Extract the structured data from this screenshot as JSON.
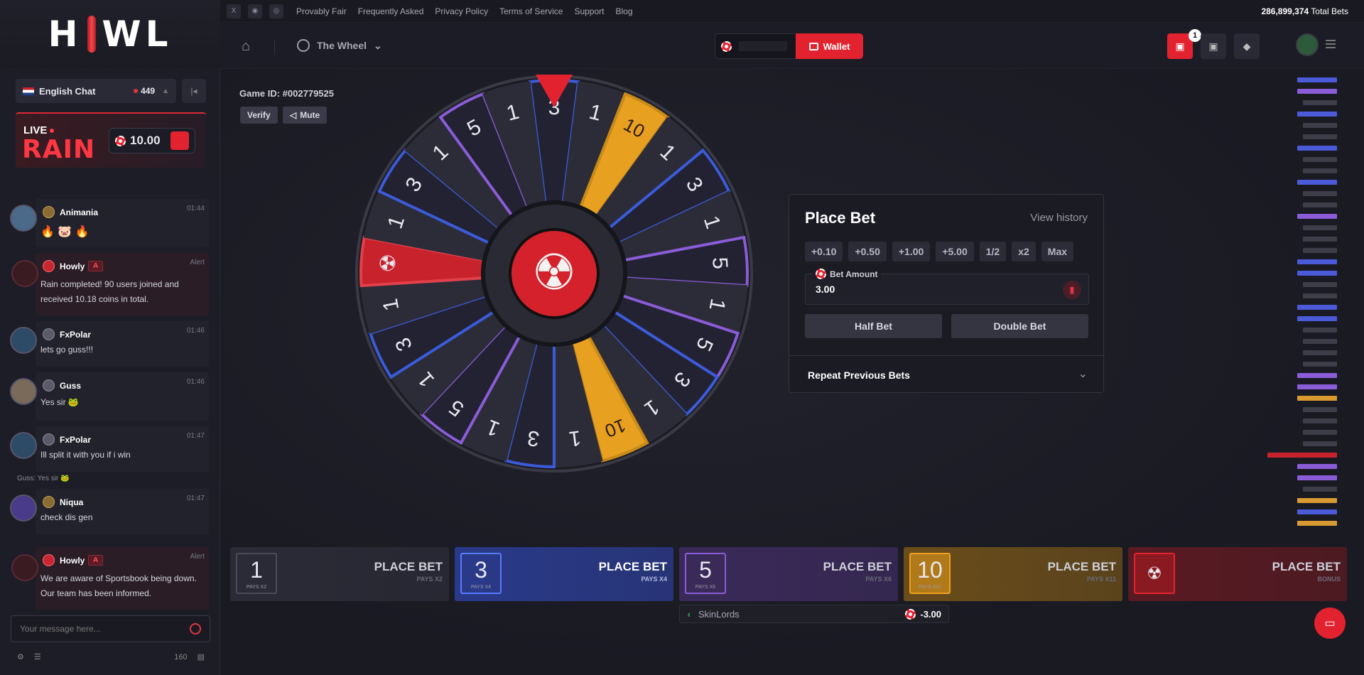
{
  "brand": {
    "logo_text_left": "H",
    "logo_text_right": "WL"
  },
  "chat": {
    "room": "English Chat",
    "online": "449",
    "rain": {
      "live": "LIVE",
      "word": "RAIN",
      "amount": "10.00"
    },
    "messages": [
      {
        "user": "Animania",
        "time": "01:44",
        "text": "",
        "emojis": "🔥 🐷 🔥"
      },
      {
        "user": "Howly",
        "tag": "A",
        "time": "Alert",
        "text": "Rain completed! 90 users joined and received 10.18 coins in total."
      },
      {
        "user": "FxPolar",
        "time": "01:46",
        "text": "lets go guss!!!"
      },
      {
        "user": "Guss",
        "time": "01:46",
        "text": "Yes sir"
      },
      {
        "user": "FxPolar",
        "time": "01:47",
        "text": "Ill split it with you if i win"
      },
      {
        "reply": "Guss: Yes sir"
      },
      {
        "user": "Niqua",
        "time": "01:47",
        "text": "check dis gen"
      },
      {
        "user": "Howly",
        "tag": "A",
        "time": "Alert",
        "text": "We are aware of Sportsbook being down. Our team has been informed."
      }
    ],
    "input_placeholder": "Your message here...",
    "online_count": "160"
  },
  "topbar": {
    "social_x": "X",
    "links": [
      "Provably Fair",
      "Frequently Asked",
      "Privacy Policy",
      "Terms of Service",
      "Support",
      "Blog"
    ],
    "total_bets_value": "286,899,374",
    "total_bets_label": "Total Bets"
  },
  "header": {
    "game": "The Wheel",
    "wallet": "Wallet",
    "gift_count": "1"
  },
  "game": {
    "id": "Game ID: #002779525",
    "verify": "Verify",
    "mute": "Mute",
    "wheel_segments": [
      "3",
      "1",
      "10",
      "1",
      "3",
      "1",
      "5",
      "1",
      "5",
      "3",
      "1",
      "10",
      "1",
      "3",
      "1",
      "5",
      "1",
      "3",
      "1",
      "bonus",
      "1",
      "3",
      "1",
      "5",
      "1"
    ]
  },
  "place_bet": {
    "title": "Place Bet",
    "history": "View history",
    "quick": [
      "+0.10",
      "+0.50",
      "+1.00",
      "+5.00",
      "1/2",
      "x2",
      "Max"
    ],
    "amount_label": "Bet Amount",
    "amount": "3.00",
    "half": "Half Bet",
    "double": "Double Bet",
    "repeat": "Repeat Previous Bets"
  },
  "bet_options": [
    {
      "num": "1",
      "num_pays": "PAYS X2",
      "cta": "PLACE BET",
      "pays": "PAYS X2",
      "color": "#2b2b37"
    },
    {
      "num": "3",
      "num_pays": "PAYS X4",
      "cta": "PLACE BET",
      "pays": "PAYS X4",
      "color": "#2a3a8a"
    },
    {
      "num": "5",
      "num_pays": "PAYS X6",
      "cta": "PLACE BET",
      "pays": "PAYS X6",
      "color": "#3a2a5a"
    },
    {
      "num": "10",
      "num_pays": "PAYS X11",
      "cta": "PLACE BET",
      "pays": "PAYS X11",
      "color": "#6a4d1a"
    },
    {
      "num": "",
      "num_pays": "",
      "cta": "PLACE BET",
      "pays": "BONUS",
      "color": "#5a1a22"
    }
  ],
  "my_bet": {
    "user": "SkinLords",
    "amount": "-3.00"
  },
  "colors": {
    "accent": "#e2232f",
    "blue": "#3b5bdb",
    "purple": "#8a5cd8",
    "gold": "#f0a020"
  }
}
